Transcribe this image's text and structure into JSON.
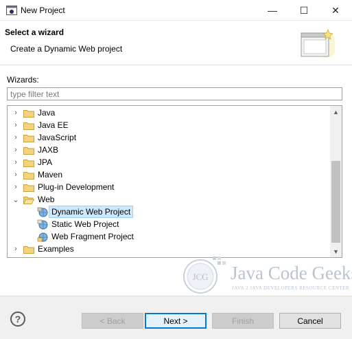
{
  "window": {
    "title": "New Project",
    "minimize_glyph": "—",
    "maximize_glyph": "☐",
    "close_glyph": "✕"
  },
  "header": {
    "title": "Select a wizard",
    "description": "Create a Dynamic Web project"
  },
  "wizards_label": "Wizards:",
  "filter": {
    "value": "",
    "placeholder": "type filter text"
  },
  "tree": {
    "items": [
      {
        "label": "Java",
        "type": "folder",
        "expanded": false,
        "level": 0
      },
      {
        "label": "Java EE",
        "type": "folder",
        "expanded": false,
        "level": 0
      },
      {
        "label": "JavaScript",
        "type": "folder",
        "expanded": false,
        "level": 0
      },
      {
        "label": "JAXB",
        "type": "folder",
        "expanded": false,
        "level": 0
      },
      {
        "label": "JPA",
        "type": "folder",
        "expanded": false,
        "level": 0
      },
      {
        "label": "Maven",
        "type": "folder",
        "expanded": false,
        "level": 0
      },
      {
        "label": "Plug-in Development",
        "type": "folder",
        "expanded": false,
        "level": 0
      },
      {
        "label": "Web",
        "type": "folder",
        "expanded": true,
        "level": 0
      },
      {
        "label": "Dynamic Web Project",
        "type": "wizard",
        "selected": true,
        "level": 1
      },
      {
        "label": "Static Web Project",
        "type": "wizard",
        "selected": false,
        "level": 1
      },
      {
        "label": "Web Fragment Project",
        "type": "wizard",
        "selected": false,
        "level": 1
      },
      {
        "label": "Examples",
        "type": "folder",
        "expanded": false,
        "level": 0
      }
    ]
  },
  "watermark": {
    "text": "Java Code Geeks",
    "subtitle": "JAVA 2 JAVA DEVELOPERS RESOURCE CENTER",
    "logo_text": "JCG"
  },
  "footer": {
    "help_glyph": "?",
    "back_label": "< Back",
    "next_label": "Next >",
    "finish_label": "Finish",
    "cancel_label": "Cancel"
  },
  "colors": {
    "selection_bg": "#cce8ff",
    "folder": "#e8c25d",
    "default_button_border": "#0078d7"
  }
}
